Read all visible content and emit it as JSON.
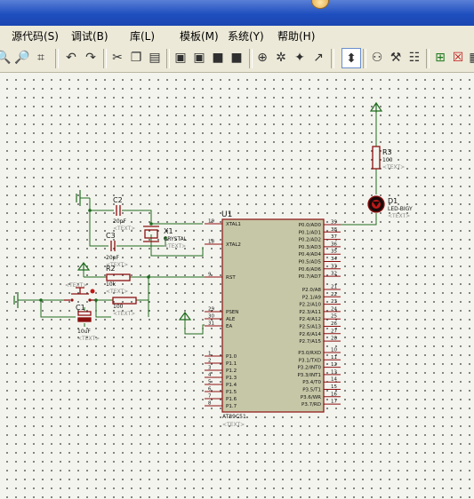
{
  "menu": {
    "items": [
      "源代码(S)",
      "调试(B)",
      "库(L)",
      "模板(M)",
      "系统(Y)",
      "帮助(H)"
    ]
  },
  "toolbar": {
    "icons": [
      "zoom-in-icon",
      "zoom-out-icon",
      "zoom-area-icon",
      "undo-icon",
      "redo-icon",
      "cut-icon",
      "copy-icon",
      "paste-icon",
      "block-copy-icon",
      "block-move-icon",
      "block-rotate-icon",
      "block-delete-icon",
      "pick-device-icon",
      "make-device-icon",
      "package-tool-icon",
      "decompose-icon",
      "wire-autoroute-icon",
      "search-tag-icon",
      "property-assign-icon",
      "new-sheet-icon",
      "remove-sheet-icon",
      "goto-sheet-icon"
    ]
  },
  "schematic": {
    "u1": {
      "ref": "U1",
      "part": "AT89C51",
      "text": "<TEXT>",
      "left_pins": [
        {
          "num": "19",
          "name": "XTAL1"
        },
        {
          "num": "18",
          "name": "XTAL2"
        },
        {
          "num": "9",
          "name": "RST"
        },
        {
          "num": "29",
          "name": "PSEN"
        },
        {
          "num": "30",
          "name": "ALE"
        },
        {
          "num": "31",
          "name": "EA"
        },
        {
          "num": "1",
          "name": "P1.0"
        },
        {
          "num": "2",
          "name": "P1.1"
        },
        {
          "num": "3",
          "name": "P1.2"
        },
        {
          "num": "4",
          "name": "P1.3"
        },
        {
          "num": "5",
          "name": "P1.4"
        },
        {
          "num": "6",
          "name": "P1.5"
        },
        {
          "num": "7",
          "name": "P1.6"
        },
        {
          "num": "8",
          "name": "P1.7"
        }
      ],
      "right_pins": [
        {
          "num": "39",
          "name": "P0.0/AD0"
        },
        {
          "num": "38",
          "name": "P0.1/AD1"
        },
        {
          "num": "37",
          "name": "P0.2/AD2"
        },
        {
          "num": "36",
          "name": "P0.3/AD3"
        },
        {
          "num": "35",
          "name": "P0.4/AD4"
        },
        {
          "num": "34",
          "name": "P0.5/AD5"
        },
        {
          "num": "33",
          "name": "P0.6/AD6"
        },
        {
          "num": "32",
          "name": "P0.7/AD7"
        },
        {
          "num": "21",
          "name": "P2.0/A8"
        },
        {
          "num": "22",
          "name": "P2.1/A9"
        },
        {
          "num": "23",
          "name": "P2.2/A10"
        },
        {
          "num": "24",
          "name": "P2.3/A11"
        },
        {
          "num": "25",
          "name": "P2.4/A12"
        },
        {
          "num": "26",
          "name": "P2.5/A13"
        },
        {
          "num": "27",
          "name": "P2.6/A14"
        },
        {
          "num": "28",
          "name": "P2.7/A15"
        },
        {
          "num": "10",
          "name": "P3.0/RXD"
        },
        {
          "num": "11",
          "name": "P3.1/TXD"
        },
        {
          "num": "12",
          "name": "P3.2/INT0"
        },
        {
          "num": "13",
          "name": "P3.3/INT1"
        },
        {
          "num": "14",
          "name": "P3.4/T0"
        },
        {
          "num": "15",
          "name": "P3.5/T1"
        },
        {
          "num": "16",
          "name": "P3.6/WR"
        },
        {
          "num": "17",
          "name": "P3.7/RD"
        }
      ]
    },
    "c1": {
      "ref": "C1",
      "value": "10uF",
      "text": "<TEXT>"
    },
    "c2": {
      "ref": "C2",
      "value": "20pF",
      "text": "<TEXT>"
    },
    "c3": {
      "ref": "C3",
      "value": "20pF",
      "text": "<TEXT>"
    },
    "x1": {
      "ref": "X1",
      "value": "CRYSTAL",
      "text": "<TEXT>"
    },
    "r2": {
      "ref": "R2",
      "value": "10k",
      "text": "<TEXT>"
    },
    "r1": {
      "value": "100",
      "text": "<TEXT>"
    },
    "r3": {
      "ref": "R3",
      "value": "100",
      "text": "<TEXT>"
    },
    "d1": {
      "ref": "D1",
      "value": "LED-BIGY",
      "text": "<TEXT>"
    },
    "sw": {
      "text": "<TEXT>"
    }
  },
  "colors": {
    "wire": "#1f6b1f",
    "component": "#8b1010",
    "chip_body": "#c6c7a6",
    "grid_dot": "#202020",
    "titlebar": "#1f4fbf"
  }
}
